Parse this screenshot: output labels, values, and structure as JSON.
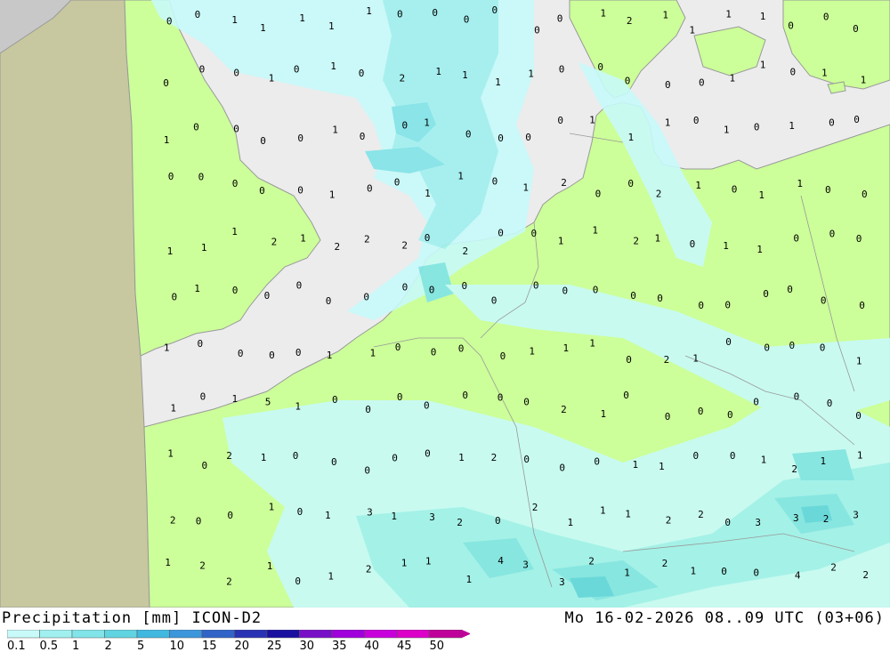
{
  "title": "Precipitation [mm] ICON-D2",
  "timestamp": "Mo 16-02-2026 08..09 UTC (03+06)",
  "colors": {
    "sea": "#ececec",
    "land_in_domain": "#ccff99",
    "land_outside_domain": "#c8c8a0",
    "sea_outside_domain": "#c8c8c8",
    "coast": "#999999"
  },
  "legend": {
    "labels": [
      "0.1",
      "0.5",
      "1",
      "2",
      "5",
      "10",
      "15",
      "20",
      "25",
      "30",
      "35",
      "40",
      "45",
      "50"
    ],
    "colors": [
      "#c8fafa",
      "#a0f0f0",
      "#80e4e8",
      "#60d4e0",
      "#40b8e0",
      "#3c96dc",
      "#3264c8",
      "#2832b4",
      "#1a10a0",
      "#7810c8",
      "#a000dc",
      "#c800dc",
      "#dc00c8",
      "#c0009a"
    ]
  },
  "precip_values": [
    "0",
    "0",
    "1",
    "1",
    "1",
    "1",
    "1",
    "0",
    "0",
    "0",
    "0",
    "0",
    "0",
    "1",
    "2",
    "1",
    "1",
    "1",
    "1",
    "0",
    "0",
    "0",
    "0",
    "0",
    "0",
    "1",
    "0",
    "1",
    "0",
    "2",
    "1",
    "1",
    "1",
    "1",
    "0",
    "0",
    "0",
    "0",
    "0",
    "1",
    "1",
    "0",
    "1",
    "1",
    "1",
    "0",
    "0",
    "0",
    "0",
    "1",
    "0",
    "0",
    "1",
    "0",
    "0",
    "0",
    "0",
    "1",
    "1",
    "1",
    "0",
    "1",
    "0",
    "1",
    "0",
    "0",
    "0",
    "0",
    "0",
    "0",
    "0",
    "1",
    "0",
    "0",
    "1",
    "1",
    "0",
    "1",
    "2",
    "0",
    "0",
    "2",
    "1",
    "0",
    "1",
    "1",
    "0",
    "0",
    "1",
    "1",
    "1",
    "2",
    "1",
    "2",
    "2",
    "2",
    "0",
    "2",
    "0",
    "0",
    "1",
    "1",
    "2",
    "1",
    "0",
    "1",
    "1",
    "0",
    "0",
    "0",
    "0",
    "1",
    "0",
    "0",
    "0",
    "0",
    "0",
    "0",
    "0",
    "0",
    "0",
    "0",
    "0",
    "0",
    "0",
    "0",
    "0",
    "0",
    "0",
    "0",
    "0",
    "0",
    "1",
    "0",
    "0",
    "0",
    "0",
    "1",
    "1",
    "0",
    "0",
    "0",
    "0",
    "1",
    "1",
    "1",
    "0",
    "2",
    "1",
    "0",
    "0",
    "0",
    "0",
    "1",
    "1",
    "0",
    "1",
    "5",
    "1",
    "0",
    "0",
    "0",
    "0",
    "0",
    "0",
    "0",
    "2",
    "1",
    "0",
    "0",
    "0",
    "0",
    "0",
    "0",
    "0",
    "0",
    "1",
    "0",
    "2",
    "1",
    "0",
    "0",
    "0",
    "0",
    "0",
    "1",
    "2",
    "0",
    "0",
    "0",
    "1",
    "1",
    "0",
    "0",
    "1",
    "2",
    "1",
    "1",
    "2",
    "0",
    "0",
    "1",
    "0",
    "1",
    "3",
    "1",
    "3",
    "2",
    "0",
    "2",
    "1",
    "1",
    "1",
    "2",
    "2",
    "0",
    "3",
    "3",
    "2",
    "3",
    "1",
    "2",
    "2",
    "1",
    "0",
    "1",
    "2",
    "1",
    "1",
    "1",
    "4",
    "3",
    "3",
    "2",
    "1",
    "2",
    "1",
    "0",
    "0",
    "4",
    "2",
    "2"
  ]
}
